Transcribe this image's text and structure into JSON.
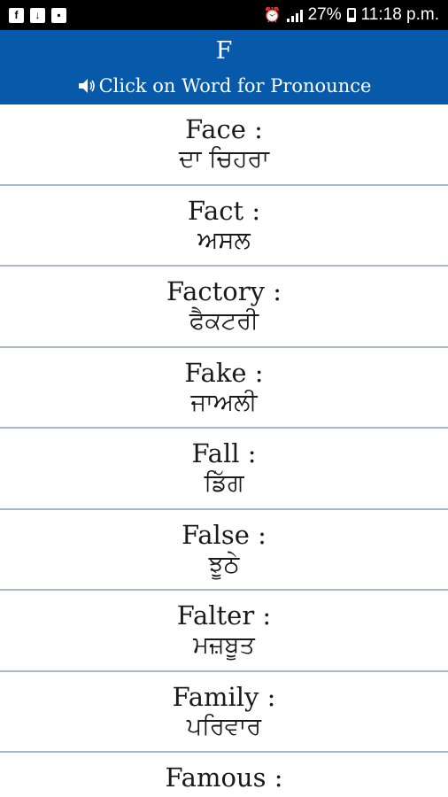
{
  "status_bar": {
    "left_icons": [
      "facebook-icon",
      "download-icon",
      "bag-icon"
    ],
    "alarm_icon": "alarm-icon",
    "battery_percent": "27%",
    "battery_level": 0.27,
    "time": "11:18 p.m."
  },
  "header": {
    "letter": "F",
    "subtitle": "Click on Word for Pronounce",
    "background": "#0759a9"
  },
  "words": [
    {
      "english": "Face :",
      "punjabi": "ਦਾ ਚਿਹਰਾ"
    },
    {
      "english": "Fact :",
      "punjabi": "ਅਸਲ"
    },
    {
      "english": "Factory :",
      "punjabi": "ਫੈਕਟਰੀ"
    },
    {
      "english": "Fake :",
      "punjabi": "ਜਾਅਲੀ"
    },
    {
      "english": "Fall :",
      "punjabi": "ਡਿੱਗ"
    },
    {
      "english": "False :",
      "punjabi": "ਝੂਠੇ"
    },
    {
      "english": "Falter :",
      "punjabi": "ਮਜ਼ਬੂਤ"
    },
    {
      "english": "Family :",
      "punjabi": "ਪਰਿਵਾਰ"
    },
    {
      "english": "Famous :",
      "punjabi": ""
    }
  ]
}
